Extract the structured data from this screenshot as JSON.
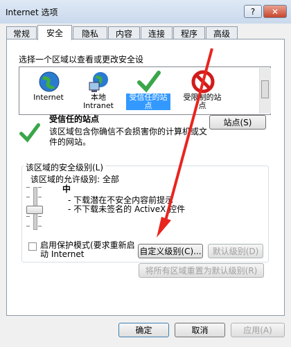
{
  "window": {
    "title": "Internet 选项",
    "help_label": "?",
    "close_label": "✕"
  },
  "tabs": [
    "常规",
    "安全",
    "隐私",
    "内容",
    "连接",
    "程序",
    "高级"
  ],
  "active_tab": "安全",
  "zones": {
    "prompt": "选择一个区域以查看或更改安全设",
    "items": [
      {
        "label": "Internet",
        "icon": "globe-icon"
      },
      {
        "label": "本地 Intranet",
        "icon": "intranet-icon"
      },
      {
        "label": "受信任的站点",
        "icon": "checkmark-icon",
        "selected": true
      },
      {
        "label": "受限制的站点",
        "icon": "restricted-icon"
      }
    ]
  },
  "zone_info": {
    "title": "受信任的站点",
    "description": "该区域包含你确信不会损害你的计算机或文件的网站。",
    "sites_button": "站点(S)"
  },
  "security_level": {
    "group_title": "该区域的安全级别(L)",
    "allowed_level": "该区域的允许级别: 全部",
    "level_name": "中",
    "bullets": [
      "- 下载潜在不安全内容前提示",
      "- 不下载未签名的 ActiveX 控件"
    ],
    "protected_mode": "启用保护模式(要求重新启动 Internet",
    "custom_button": "自定义级别(C)...",
    "default_button": "默认级别(D)",
    "reset_all_button": "将所有区域重置为默认级别(R)"
  },
  "footer": {
    "ok": "确定",
    "cancel": "取消",
    "apply": "应用(A)"
  }
}
